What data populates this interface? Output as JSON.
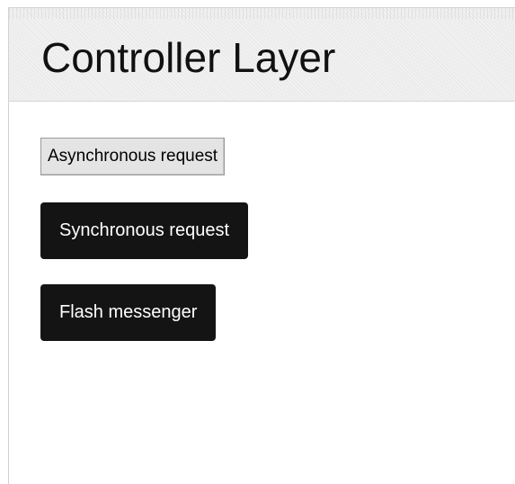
{
  "header": {
    "title": "Controller Layer"
  },
  "buttons": {
    "async_label": "Asynchronous request",
    "sync_label": "Synchronous request",
    "flash_label": "Flash messenger"
  },
  "colors": {
    "header_background": "#f1f1f1",
    "dark_button": "#141414",
    "dark_button_text": "#ffffff",
    "default_button": "#e4e4e4"
  }
}
